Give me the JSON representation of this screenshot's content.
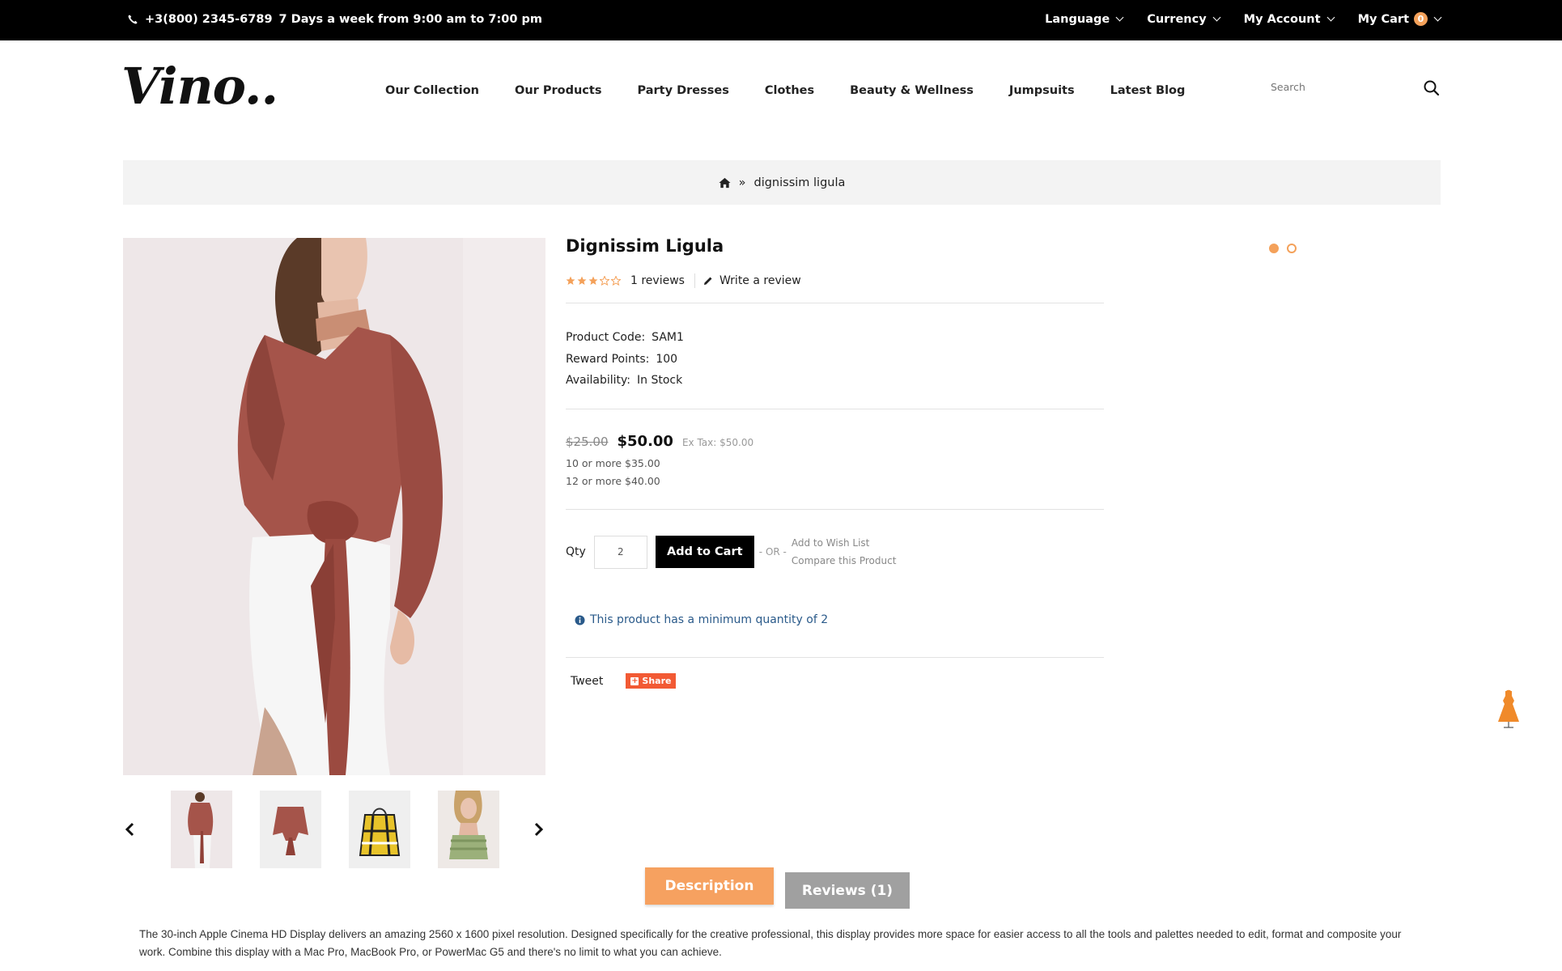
{
  "topbar": {
    "phone": "+3(800) 2345-6789",
    "hours": "7 Days a week from 9:00 am to 7:00 pm",
    "language_label": "Language",
    "currency_label": "Currency",
    "account_label": "My Account",
    "cart_label": "My Cart",
    "cart_count": "0"
  },
  "brand": {
    "logo_text": "Vino.."
  },
  "nav": {
    "items": [
      "Our Collection",
      "Our Products",
      "Party Dresses",
      "Clothes",
      "Beauty & Wellness",
      "Jumpsuits",
      "Latest Blog"
    ]
  },
  "search": {
    "placeholder": "Search"
  },
  "breadcrumb": {
    "separator": "»",
    "current": "dignissim ligula"
  },
  "product": {
    "title": "Dignissim Ligula",
    "rating": 3,
    "rating_max": 5,
    "reviews_text": "1 reviews",
    "write_review": "Write a review",
    "specs": [
      {
        "label": "Product Code:",
        "value": "SAM1"
      },
      {
        "label": "Reward Points:",
        "value": "100"
      },
      {
        "label": "Availability:",
        "value": "In Stock"
      }
    ],
    "old_price": "$25.00",
    "price": "$50.00",
    "ex_tax": "Ex Tax: $50.00",
    "discounts": [
      "10 or more $35.00",
      "12 or more $40.00"
    ],
    "qty_label": "Qty",
    "qty_value": "2",
    "add_to_cart": "Add to Cart",
    "or_text": "- OR -",
    "wish_list": "Add to Wish List",
    "compare": "Compare this Product",
    "min_qty_notice": "This product has a minimum quantity of 2",
    "tweet": "Tweet",
    "share": "Share"
  },
  "tabs": {
    "description_label": "Description",
    "reviews_label": "Reviews (1)"
  },
  "description": "The 30-inch Apple Cinema HD Display delivers an amazing 2560 x 1600 pixel resolution. Designed specifically for the creative professional, this display provides more space for easier access to all the tools and palettes needed to edit, format and composite your work. Combine this display with a Mac Pro, MacBook Pro, or PowerMac G5 and there's no limit to what you can achieve.",
  "colors": {
    "accent": "#f4a15a",
    "share": "#f25a34",
    "notice": "#2a5a8a",
    "tab_active": "#f6a160",
    "tab_inactive": "#a0a0a0"
  }
}
